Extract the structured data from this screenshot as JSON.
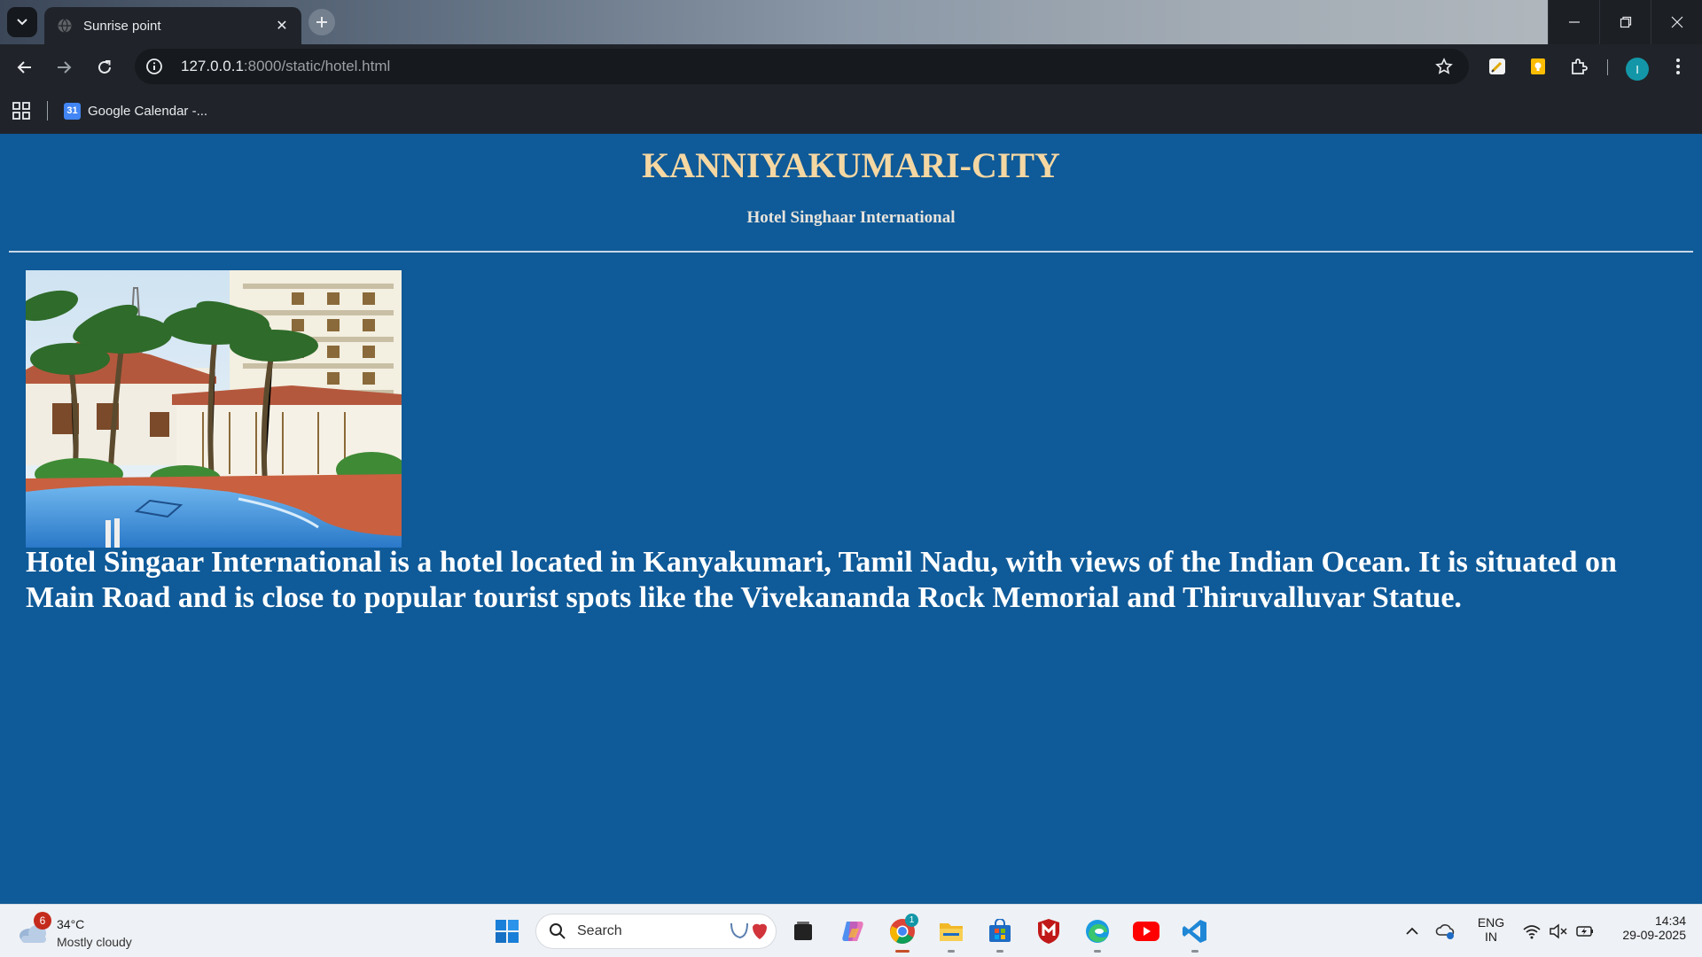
{
  "browser": {
    "tab": {
      "title": "Sunrise point"
    },
    "address": {
      "host": "127.0.0.1",
      "rest": ":8000/static/hotel.html"
    },
    "bookmarks": [
      {
        "label": "Google Calendar -..."
      }
    ],
    "profile_initial": "I"
  },
  "page": {
    "title": "KANNIYAKUMARI-CITY",
    "subtitle": "Hotel Singhaar International",
    "description": "Hotel Singaar International is a hotel located in Kanyakumari, Tamil Nadu, with views of the Indian Ocean. It is situated on Main Road and is close to popular tourist spots like the Vivekananda Rock Memorial and Thiruvalluvar Statue.",
    "background_color": "#0f5a98",
    "title_color": "#f5d7a2"
  },
  "taskbar": {
    "weather": {
      "badge": "6",
      "temp": "34°C",
      "desc": "Mostly cloudy"
    },
    "search_label": "Search",
    "chrome_badge": "1",
    "language": {
      "line1": "ENG",
      "line2": "IN"
    },
    "clock": {
      "time": "14:34",
      "date": "29-09-2025"
    }
  }
}
